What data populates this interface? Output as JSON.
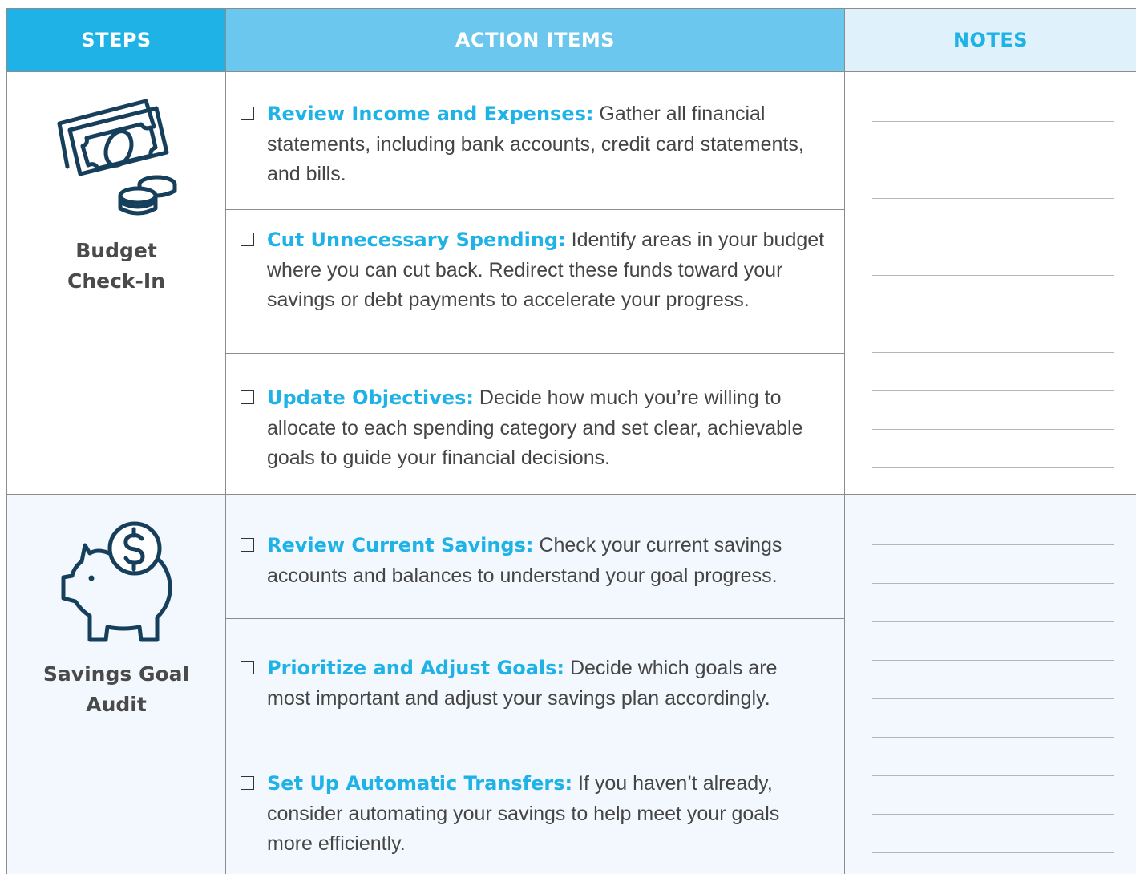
{
  "header": {
    "steps": "STEPS",
    "action_items": "ACTION ITEMS",
    "notes": "NOTES"
  },
  "colors": {
    "accent": "#1eb2e6",
    "header_mid": "#6cc7ee",
    "header_light": "#dff1fb",
    "icon": "#163f5c",
    "body_text": "#454545"
  },
  "sections": [
    {
      "label_line1": "Budget",
      "label_line2": "Check-In",
      "icon": "money-coins-icon",
      "items": [
        {
          "title": "Review Income and Expenses:",
          "text": " Gather all financial statements, including bank accounts, credit card statements, and bills."
        },
        {
          "title": "Cut Unnecessary Spending:",
          "text": " Identify areas in your budget where you can cut back. Redirect these funds toward your savings or debt payments to accelerate your progress."
        },
        {
          "title": "Update Objectives:",
          "text": " Decide how much you’re willing to allocate to each spending category and set clear, achievable goals to guide your financial decisions."
        }
      ]
    },
    {
      "label_line1": "Savings Goal",
      "label_line2": "Audit",
      "icon": "piggy-bank-icon",
      "items": [
        {
          "title": "Review Current Savings:",
          "text": " Check your current savings accounts and balances to understand your goal progress."
        },
        {
          "title": "Prioritize and Adjust Goals:",
          "text": " Decide which goals are most important and adjust your savings plan accordingly."
        },
        {
          "title": "Set Up Automatic Transfers:",
          "text": " If you haven’t already, consider automating your savings to help meet your goals more efficiently."
        }
      ]
    }
  ]
}
